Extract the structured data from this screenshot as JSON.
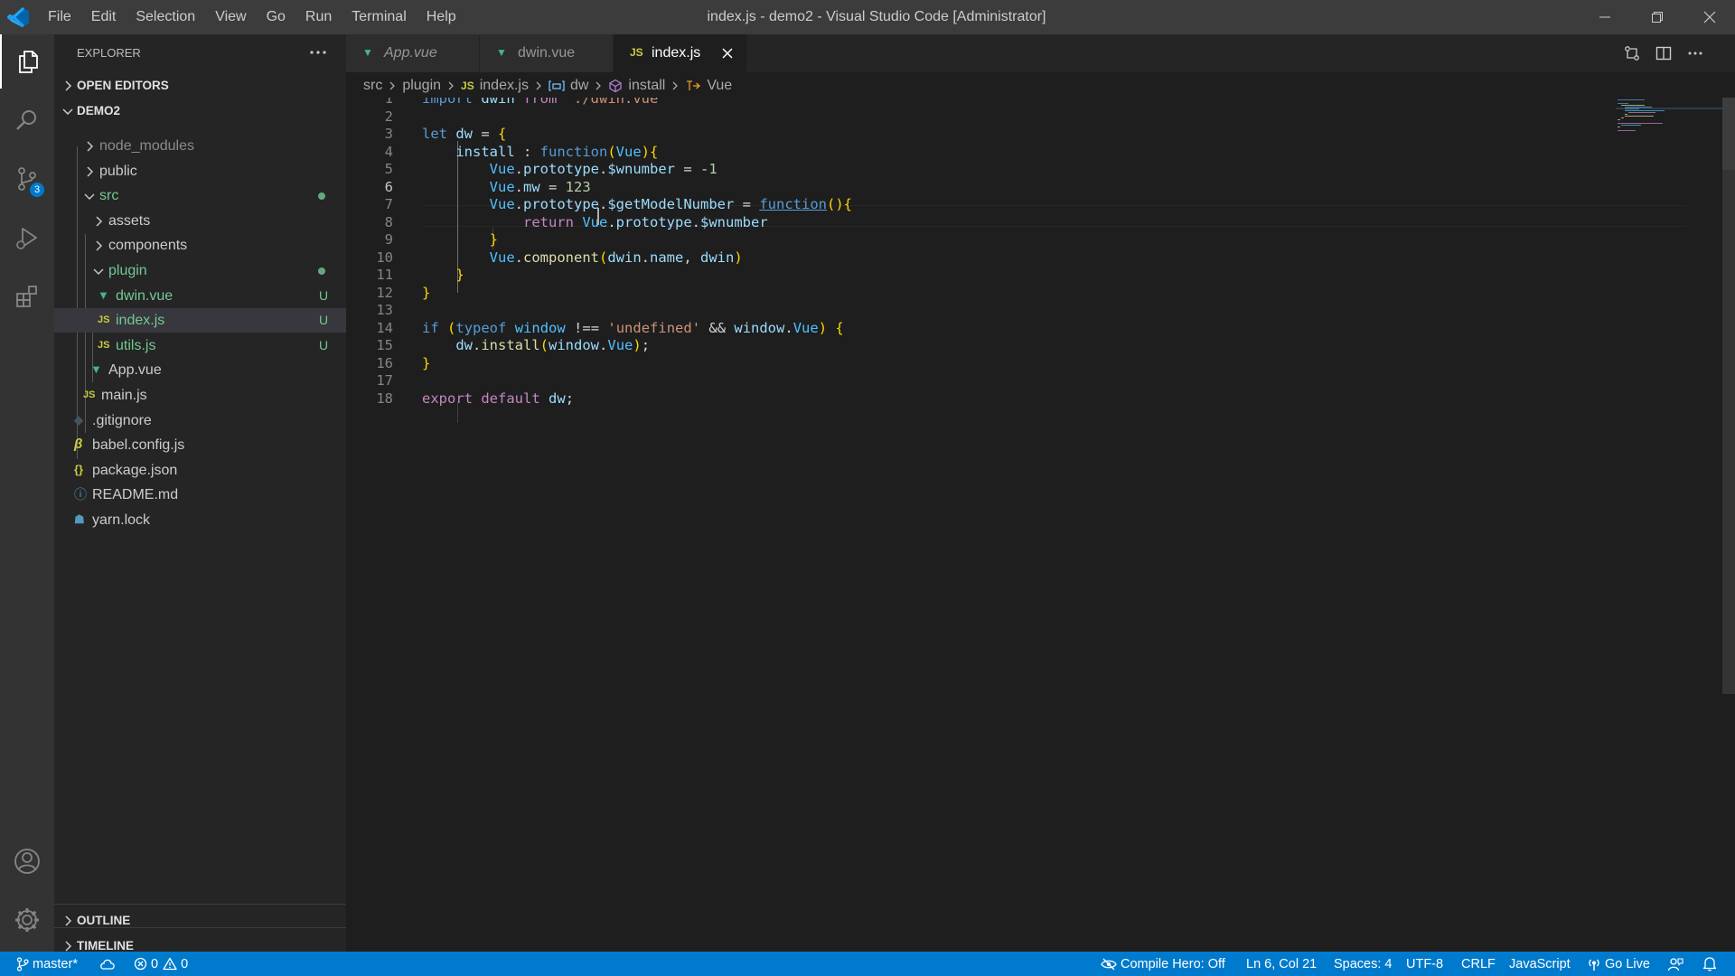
{
  "window": {
    "title": "index.js - demo2 - Visual Studio Code [Administrator]",
    "menu": [
      "File",
      "Edit",
      "Selection",
      "View",
      "Go",
      "Run",
      "Terminal",
      "Help"
    ]
  },
  "activity_bar": {
    "scm_badge": "3"
  },
  "explorer": {
    "header": "EXPLORER",
    "open_editors": "OPEN EDITORS",
    "project": "DEMO2",
    "tree": [
      {
        "name": "node_modules",
        "kind": "folder",
        "open": false,
        "color": "#8b8b8b"
      },
      {
        "name": "public",
        "kind": "folder",
        "open": false,
        "color": "#cccccc"
      },
      {
        "name": "src",
        "kind": "folder",
        "open": true,
        "color": "#73c991",
        "status": "dot"
      },
      {
        "name": "assets",
        "kind": "folder",
        "open": false,
        "color": "#cccccc"
      },
      {
        "name": "components",
        "kind": "folder",
        "open": false,
        "color": "#cccccc"
      },
      {
        "name": "plugin",
        "kind": "folder",
        "open": true,
        "color": "#73c991",
        "status": "dot"
      },
      {
        "name": "dwin.vue",
        "kind": "vue",
        "color": "#73c991",
        "status": "U"
      },
      {
        "name": "index.js",
        "kind": "js",
        "color": "#73c991",
        "status": "U",
        "selected": true
      },
      {
        "name": "utils.js",
        "kind": "js",
        "color": "#73c991",
        "status": "U"
      },
      {
        "name": "App.vue",
        "kind": "vue",
        "color": "#cccccc"
      },
      {
        "name": "main.js",
        "kind": "js",
        "color": "#cccccc"
      },
      {
        "name": ".gitignore",
        "kind": "git",
        "color": "#cccccc"
      },
      {
        "name": "babel.config.js",
        "kind": "babel",
        "color": "#cccccc"
      },
      {
        "name": "package.json",
        "kind": "json",
        "color": "#cccccc"
      },
      {
        "name": "README.md",
        "kind": "info",
        "color": "#cccccc"
      },
      {
        "name": "yarn.lock",
        "kind": "yarn",
        "color": "#cccccc"
      }
    ],
    "outline": "OUTLINE",
    "timeline": "TIMELINE"
  },
  "tabs": [
    {
      "label": "App.vue",
      "icon": "vue",
      "italic": true
    },
    {
      "label": "dwin.vue",
      "icon": "vue"
    },
    {
      "label": "index.js",
      "icon": "js",
      "active": true
    }
  ],
  "breadcrumb": [
    "src",
    "plugin",
    "index.js",
    "dw",
    "install",
    "Vue"
  ],
  "code": {
    "current_line": 6,
    "lines": [
      "import dwin from \"./dwin.vue\"",
      "",
      "let dw = {",
      "    install : function(Vue){",
      "        Vue.prototype.$wnumber = -1",
      "        Vue.mw = 123",
      "        Vue.prototype.$getModelNumber = function(){",
      "            return Vue.prototype.$wnumber",
      "        }",
      "        Vue.component(dwin.name, dwin)",
      "    }",
      "}",
      "",
      "if (typeof window !== 'undefined' && window.Vue) {",
      "    dw.install(window.Vue);",
      "}",
      "",
      "export default dw;"
    ]
  },
  "status": {
    "branch": "master*",
    "errors": "0",
    "warnings": "0",
    "compile_hero": "Compile Hero: Off",
    "position": "Ln 6, Col 21",
    "spaces": "Spaces: 4",
    "encoding": "UTF-8",
    "eol": "CRLF",
    "language": "JavaScript",
    "go_live": "Go Live"
  },
  "colors": {
    "accent": "#007acc",
    "keyword": "#569cd6",
    "string": "#ce9178",
    "identifier": "#4fc1ff",
    "property": "#9cdcfe",
    "function": "#dcdcaa",
    "control": "#c586c0",
    "number": "#b5cea8",
    "vue": "#41b883",
    "js": "#cbcb41",
    "git_added": "#73c991"
  }
}
